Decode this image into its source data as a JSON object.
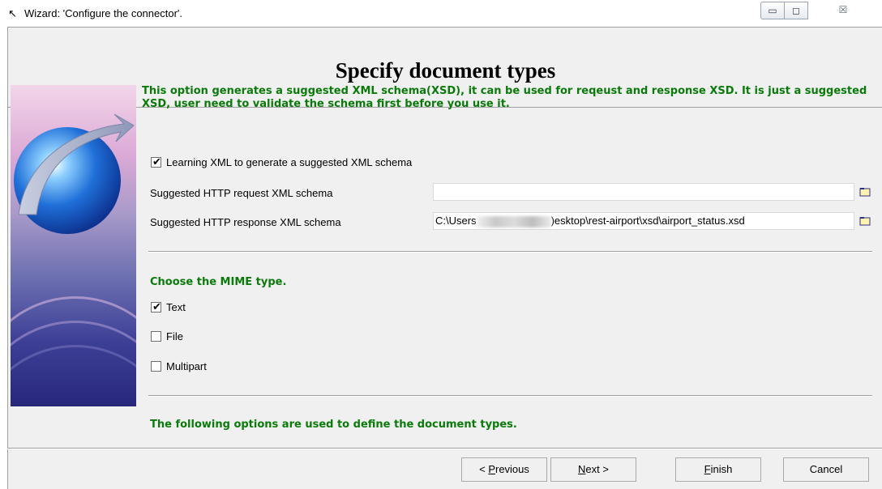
{
  "window": {
    "title": "Wizard: 'Configure the connector'.",
    "title_icon": "wizard-wand-icon",
    "minimize_glyph": "▭",
    "maximize_glyph": "◻",
    "close_glyph": "☒"
  },
  "header": {
    "title": "Specify document types"
  },
  "schema": {
    "description": "This option generates a suggested XML schema(XSD), it can be used for reqeust and response XSD. It is just a suggested XSD, user need to validate the schema first before you use it.",
    "learning_label": "Learning XML to generate a suggested XML schema",
    "learning_checked": true,
    "request_label": "Suggested HTTP request XML schema",
    "request_value": "",
    "response_label": "Suggested HTTP response XML schema",
    "response_value_prefix": "C:\\Users",
    "response_value_suffix": ")esktop\\rest-airport\\xsd\\airport_status.xsd"
  },
  "mime": {
    "heading": "Choose the MIME type.",
    "options": [
      {
        "label": "Text",
        "checked": true
      },
      {
        "label": "File",
        "checked": false
      },
      {
        "label": "Multipart",
        "checked": false
      }
    ]
  },
  "footer_note": "The following options are used to define the document types.",
  "buttons": {
    "previous": {
      "accel": "P",
      "rest": "revious",
      "prefix": "< "
    },
    "next": {
      "accel": "N",
      "rest": "ext >"
    },
    "finish": {
      "accel": "F",
      "rest": "inish"
    },
    "cancel": "Cancel"
  },
  "colors": {
    "accent_green": "#0a7a0a",
    "dialog_bg": "#f0f0f0"
  }
}
